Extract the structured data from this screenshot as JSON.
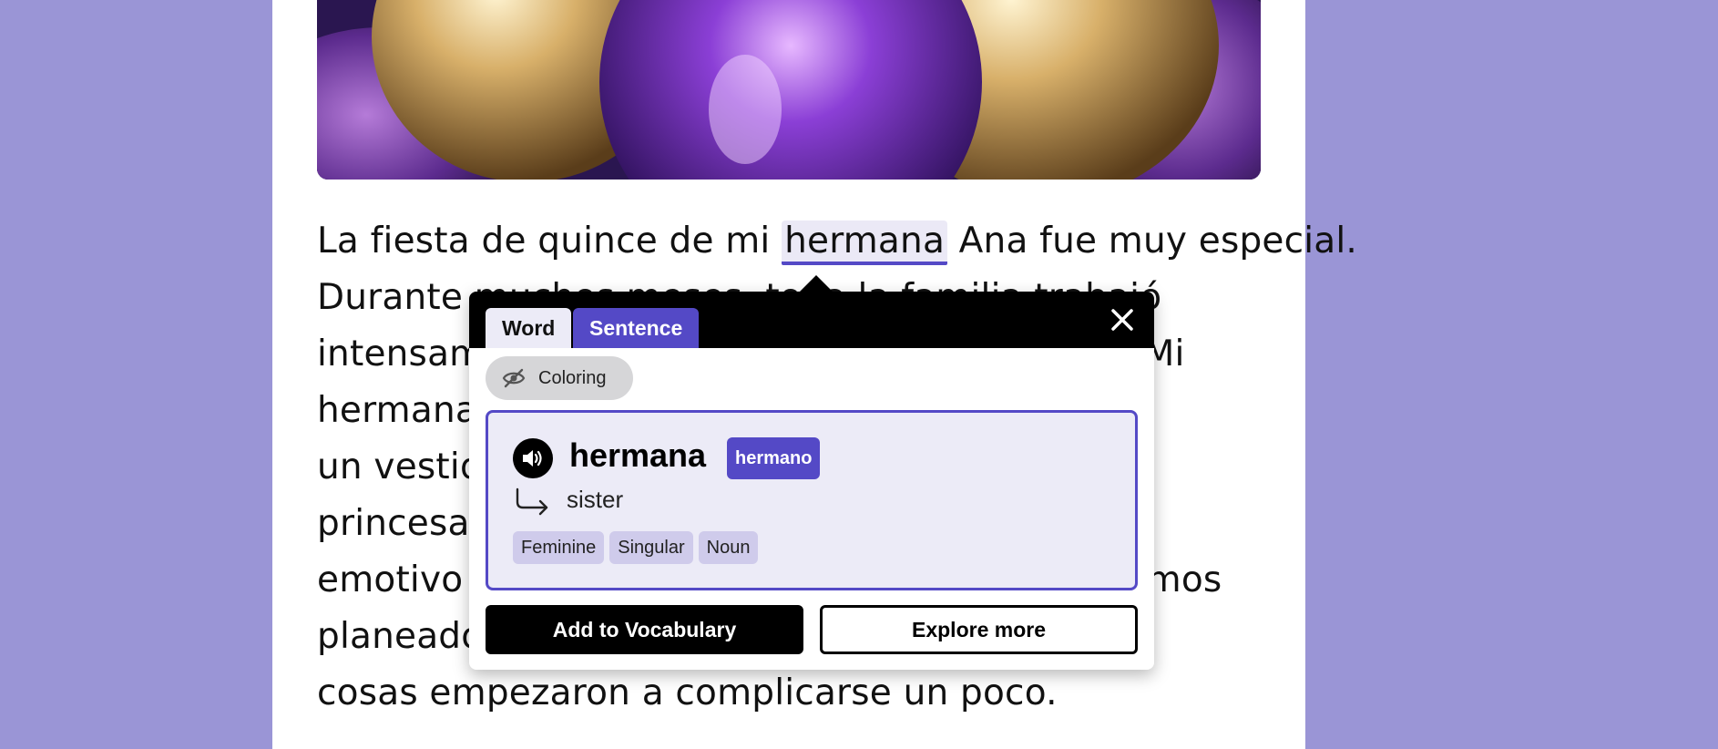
{
  "story": {
    "lines": [
      [
        "La fiesta de quince de mi ",
        "hermana",
        " Ana fue muy especial."
      ],
      [
        "Durante muchos meses, toda la familia trabajó"
      ],
      [
        "intensamente para que todo saliera perfecto. Mi"
      ],
      [
        "hermana estaba muy emocionada y se puso"
      ],
      [
        "un vestido rosa que la hacía parecer una"
      ],
      [
        "princesa. El momento del vals fue muy"
      ],
      [
        "emotivo y todo estaba saliendo como lo habíamos"
      ],
      [
        "planeado. Sin embargo, de repente, las"
      ],
      [
        "cosas empezaron a complicarse un poco."
      ]
    ]
  },
  "popup": {
    "tabs": {
      "word": "Word",
      "sentence": "Sentence"
    },
    "coloring_label": "Coloring",
    "word": "hermana",
    "lemma": "hermano",
    "translation": "sister",
    "tags": [
      "Feminine",
      "Singular",
      "Noun"
    ],
    "add_button": "Add to Vocabulary",
    "explore_button": "Explore more"
  },
  "icons": {
    "close": "close-icon",
    "coloring": "eye-slash-icon",
    "speaker": "speaker-icon",
    "translation": "arrow-turn-down-right-icon"
  },
  "colors": {
    "background": "#9a95d6",
    "accent": "#5449c6",
    "card_bg": "#ecebf7",
    "tag_bg": "#cfcbeb"
  }
}
